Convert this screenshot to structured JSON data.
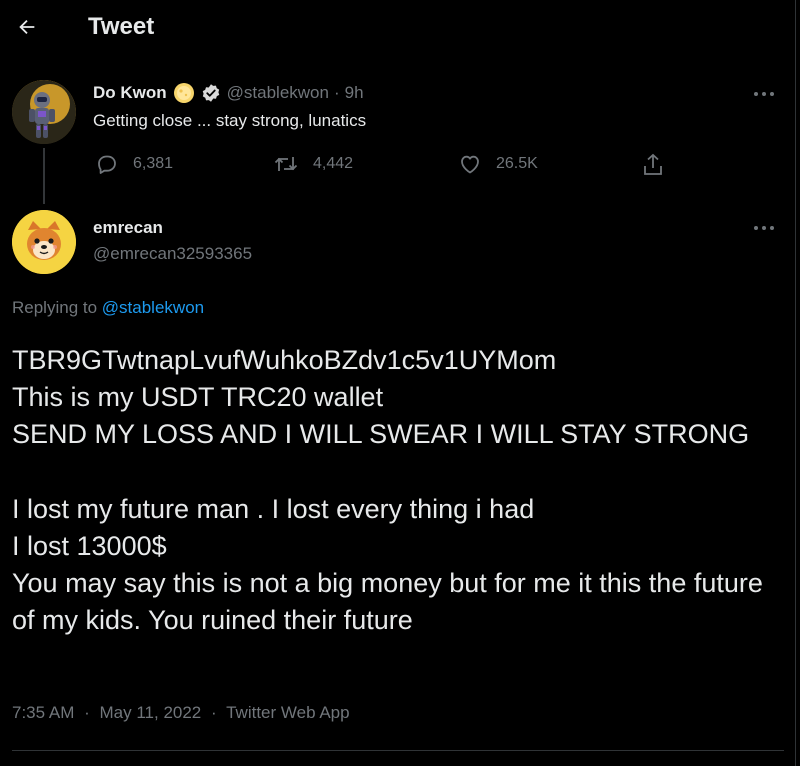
{
  "header": {
    "title": "Tweet"
  },
  "parent_tweet": {
    "display_name": "Do Kwon",
    "handle": "@stablekwon",
    "separator": "·",
    "time": "9h",
    "text": "Getting close ... stay strong, lunatics",
    "stats": {
      "replies": "6,381",
      "retweets": "4,442",
      "likes": "26.5K"
    }
  },
  "reply_tweet": {
    "display_name": "emrecan",
    "handle": "@emrecan32593365",
    "replying_to_label": "Replying to",
    "replying_to_handle": "@stablekwon",
    "lines": [
      "TBR9GTwtnapLvufWuhkoBZdv1c5v1UYMom",
      "This is my USDT TRC20 wallet",
      "SEND MY LOSS AND I WILL SWEAR I WILL STAY STRONG",
      "I lost my future man . I lost every thing i had",
      "I lost 13000$",
      "You may say this is not a big money but for me it this the future of my kids. You ruined their future"
    ],
    "timestamp": "7:35 AM",
    "date": "May 11, 2022",
    "separator": "·",
    "source": "Twitter Web App"
  },
  "icons": {
    "back": "arrow-left-icon",
    "moon_badge": "moon-badge-icon",
    "verified": "verified-badge-icon",
    "more": "more-horizontal-icon",
    "reply": "reply-icon",
    "retweet": "retweet-icon",
    "like": "heart-icon",
    "share": "share-icon"
  },
  "colors": {
    "background": "#000000",
    "text": "#e7e9ea",
    "secondary": "#71767b",
    "link": "#1d9bf0",
    "divider": "#2f3336"
  }
}
